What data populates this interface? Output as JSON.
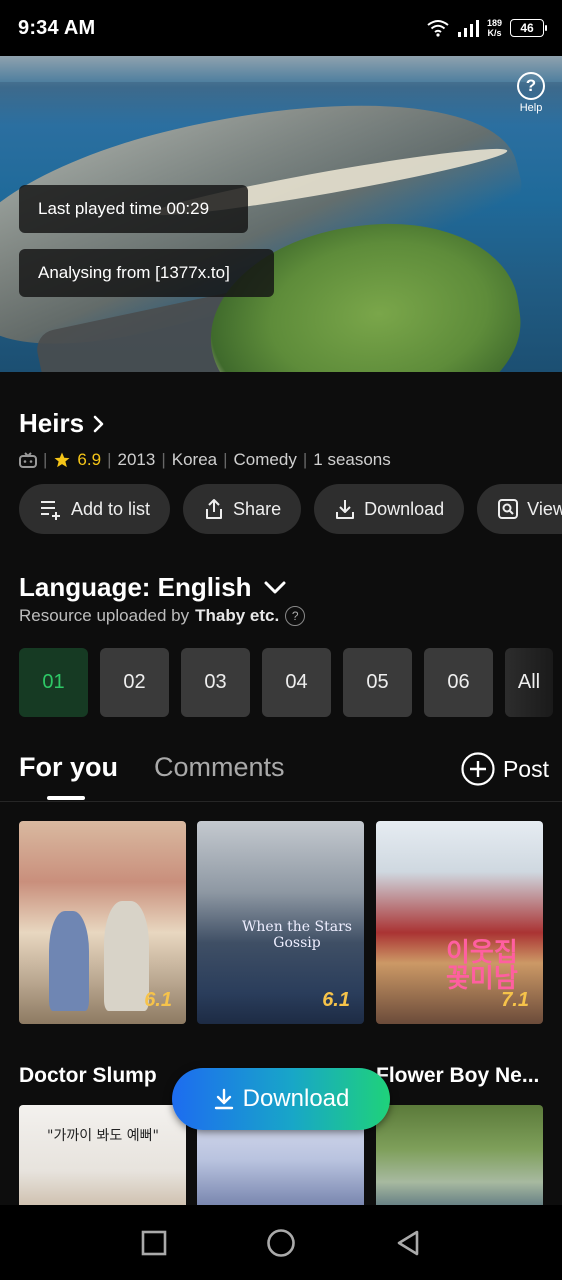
{
  "status": {
    "time": "9:34 AM",
    "net_speed_value": "189",
    "net_speed_unit": "K/s",
    "battery": "46"
  },
  "player": {
    "help_label": "Help",
    "toast_last_played": "Last played time 00:29",
    "toast_analysing": "Analysing from [1377x.to]"
  },
  "show": {
    "title": "Heirs",
    "rating": "6.9",
    "year": "2013",
    "country": "Korea",
    "genre": "Comedy",
    "seasons": "1 seasons"
  },
  "actions": {
    "add_to_list": "Add to list",
    "share": "Share",
    "download": "Download",
    "view": "View"
  },
  "language": {
    "label": "Language: English",
    "uploaded_prefix": "Resource uploaded by",
    "uploader": "Thaby etc."
  },
  "episodes": [
    "01",
    "02",
    "03",
    "04",
    "05",
    "06"
  ],
  "episodes_all": "All",
  "tabs": {
    "for_you": "For you",
    "comments": "Comments",
    "post": "Post"
  },
  "recommendations": [
    {
      "title": "Doctor Slump",
      "score": "6.1"
    },
    {
      "title": "",
      "score": "6.1",
      "poster_text": "When the Stars Gossip"
    },
    {
      "title": "Flower Boy Ne...",
      "score": "7.1",
      "poster_text": "이웃집 꽃미남"
    }
  ],
  "row2_poster_text": "\"가까이 봐도 예뻐\"",
  "fab": {
    "label": "Download"
  },
  "colors": {
    "accent_green": "#2ec866",
    "star": "#f5c518",
    "fab_start": "#1d6cf0",
    "fab_end": "#1fd27a"
  }
}
